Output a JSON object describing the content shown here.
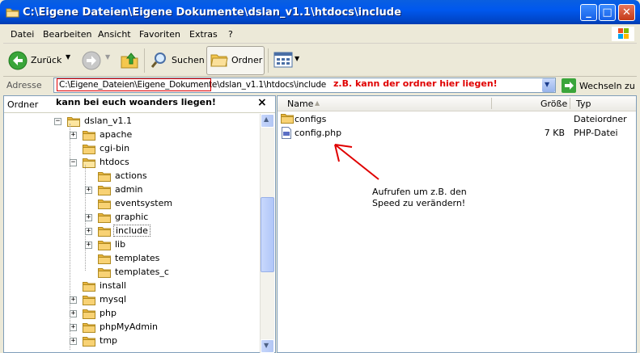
{
  "window": {
    "title": "C:\\Eigene Dateien\\Eigene Dokumente\\dslan_v1.1\\htdocs\\include",
    "minimize": "_",
    "maximize": "□",
    "close": "✕"
  },
  "menu": [
    "Datei",
    "Bearbeiten",
    "Ansicht",
    "Favoriten",
    "Extras",
    "?"
  ],
  "toolbar": {
    "back": "Zurück",
    "search": "Suchen",
    "folders": "Ordner"
  },
  "address": {
    "label": "Adresse",
    "value": "C:\\Eigene_Dateien\\Eigene_Dokumente\\dslan_v1.1\\htdocs\\include",
    "go": "Wechseln zu"
  },
  "annotations": {
    "address_note": "z.B. kann der ordner hier liegen!",
    "folder_note": "kann bei euch woanders liegen!",
    "callout": "Aufrufen um z.B. den Speed zu verändern!"
  },
  "folder_pane": {
    "title": "Ordner",
    "close": "×",
    "tree": [
      {
        "name": "dslan_v1.1",
        "expander": "−",
        "open": true
      },
      {
        "name": "apache",
        "expander": "+"
      },
      {
        "name": "cgi-bin",
        "expander": ""
      },
      {
        "name": "htdocs",
        "expander": "−",
        "open": true
      },
      {
        "name": "actions",
        "expander": ""
      },
      {
        "name": "admin",
        "expander": "+"
      },
      {
        "name": "eventsystem",
        "expander": ""
      },
      {
        "name": "graphic",
        "expander": "+"
      },
      {
        "name": "include",
        "expander": "+",
        "selected": true
      },
      {
        "name": "lib",
        "expander": "+"
      },
      {
        "name": "templates",
        "expander": ""
      },
      {
        "name": "templates_c",
        "expander": ""
      },
      {
        "name": "install",
        "expander": ""
      },
      {
        "name": "mysql",
        "expander": "+"
      },
      {
        "name": "php",
        "expander": "+"
      },
      {
        "name": "phpMyAdmin",
        "expander": "+"
      },
      {
        "name": "tmp",
        "expander": "+"
      }
    ]
  },
  "file_list": {
    "columns": [
      "Name",
      "Größe",
      "Typ"
    ],
    "rows": [
      {
        "name": "configs",
        "size": "",
        "type": "Dateiordner",
        "icon": "folder-icon"
      },
      {
        "name": "config.php",
        "size": "7 KB",
        "type": "PHP-Datei",
        "icon": "php-file-icon"
      }
    ]
  },
  "colors": {
    "title_bar": "#0058ee",
    "annotation_red": "#e00000",
    "selection": "#316ac5",
    "folder_yellow": "#f4c74e"
  }
}
